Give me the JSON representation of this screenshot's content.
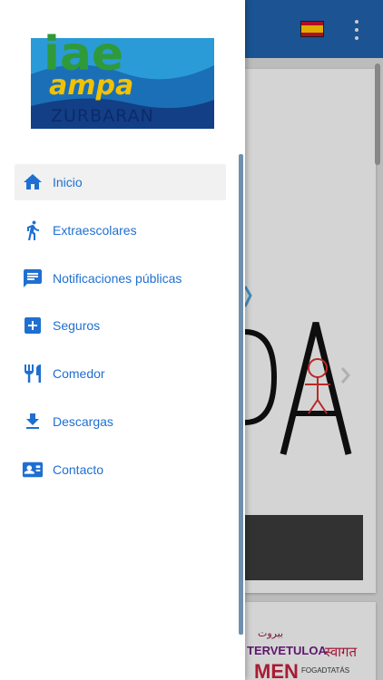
{
  "colors": {
    "accent": "#1f6fd1",
    "appbar": "#1f5fa8",
    "active_item_bg": "#f1f1f1"
  },
  "logo": {
    "line1": "iae",
    "line2": "ampa",
    "line3": "ZURBARAN"
  },
  "appbar": {
    "language_flag_icon": "spain-flag-icon",
    "overflow_icon": "more-vert-icon"
  },
  "background": {
    "card_letters": "A",
    "card2_words": [
      "بيروت",
      "TERVETULOA",
      "MEN",
      "स्वागत",
      "FOGADTATÁS"
    ]
  },
  "menu": {
    "items": [
      {
        "label": "Inicio",
        "icon": "home-icon",
        "active": true
      },
      {
        "label": "Extraescolares",
        "icon": "running-person-icon",
        "active": false
      },
      {
        "label": "Notificaciones públicas",
        "icon": "message-icon",
        "active": false
      },
      {
        "label": "Seguros",
        "icon": "medical-cross-icon",
        "active": false
      },
      {
        "label": "Comedor",
        "icon": "restaurant-icon",
        "active": false
      },
      {
        "label": "Descargas",
        "icon": "download-icon",
        "active": false
      },
      {
        "label": "Contacto",
        "icon": "contact-card-icon",
        "active": false
      }
    ]
  }
}
